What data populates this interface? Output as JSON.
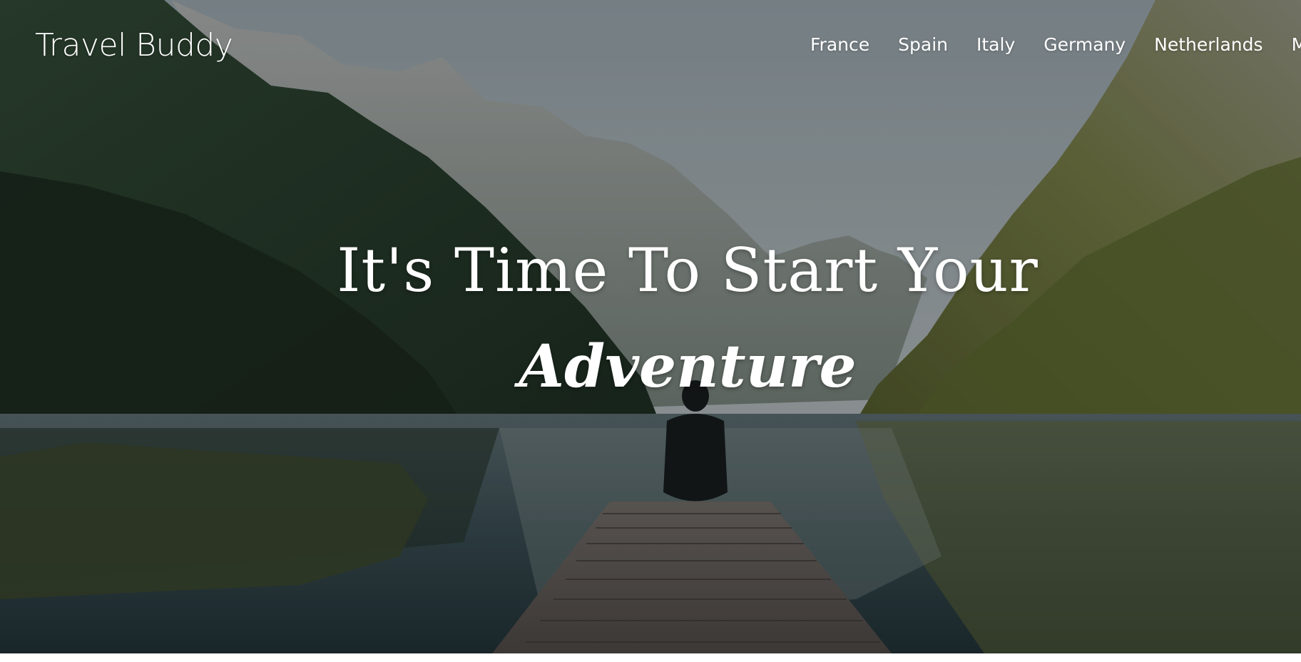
{
  "site": {
    "logo": "Travel Buddy"
  },
  "nav": {
    "items": [
      {
        "label": "France"
      },
      {
        "label": "Spain"
      },
      {
        "label": "Italy"
      },
      {
        "label": "Germany"
      },
      {
        "label": "Netherlands"
      },
      {
        "label": "Map"
      }
    ]
  },
  "hero": {
    "headline": "It's Time To Start Your",
    "headline_accent": "Adventure"
  },
  "colors": {
    "text": "#ffffff",
    "sky": "#9aa5aa",
    "water": "#2b3f45",
    "dock": "#5a5350"
  }
}
